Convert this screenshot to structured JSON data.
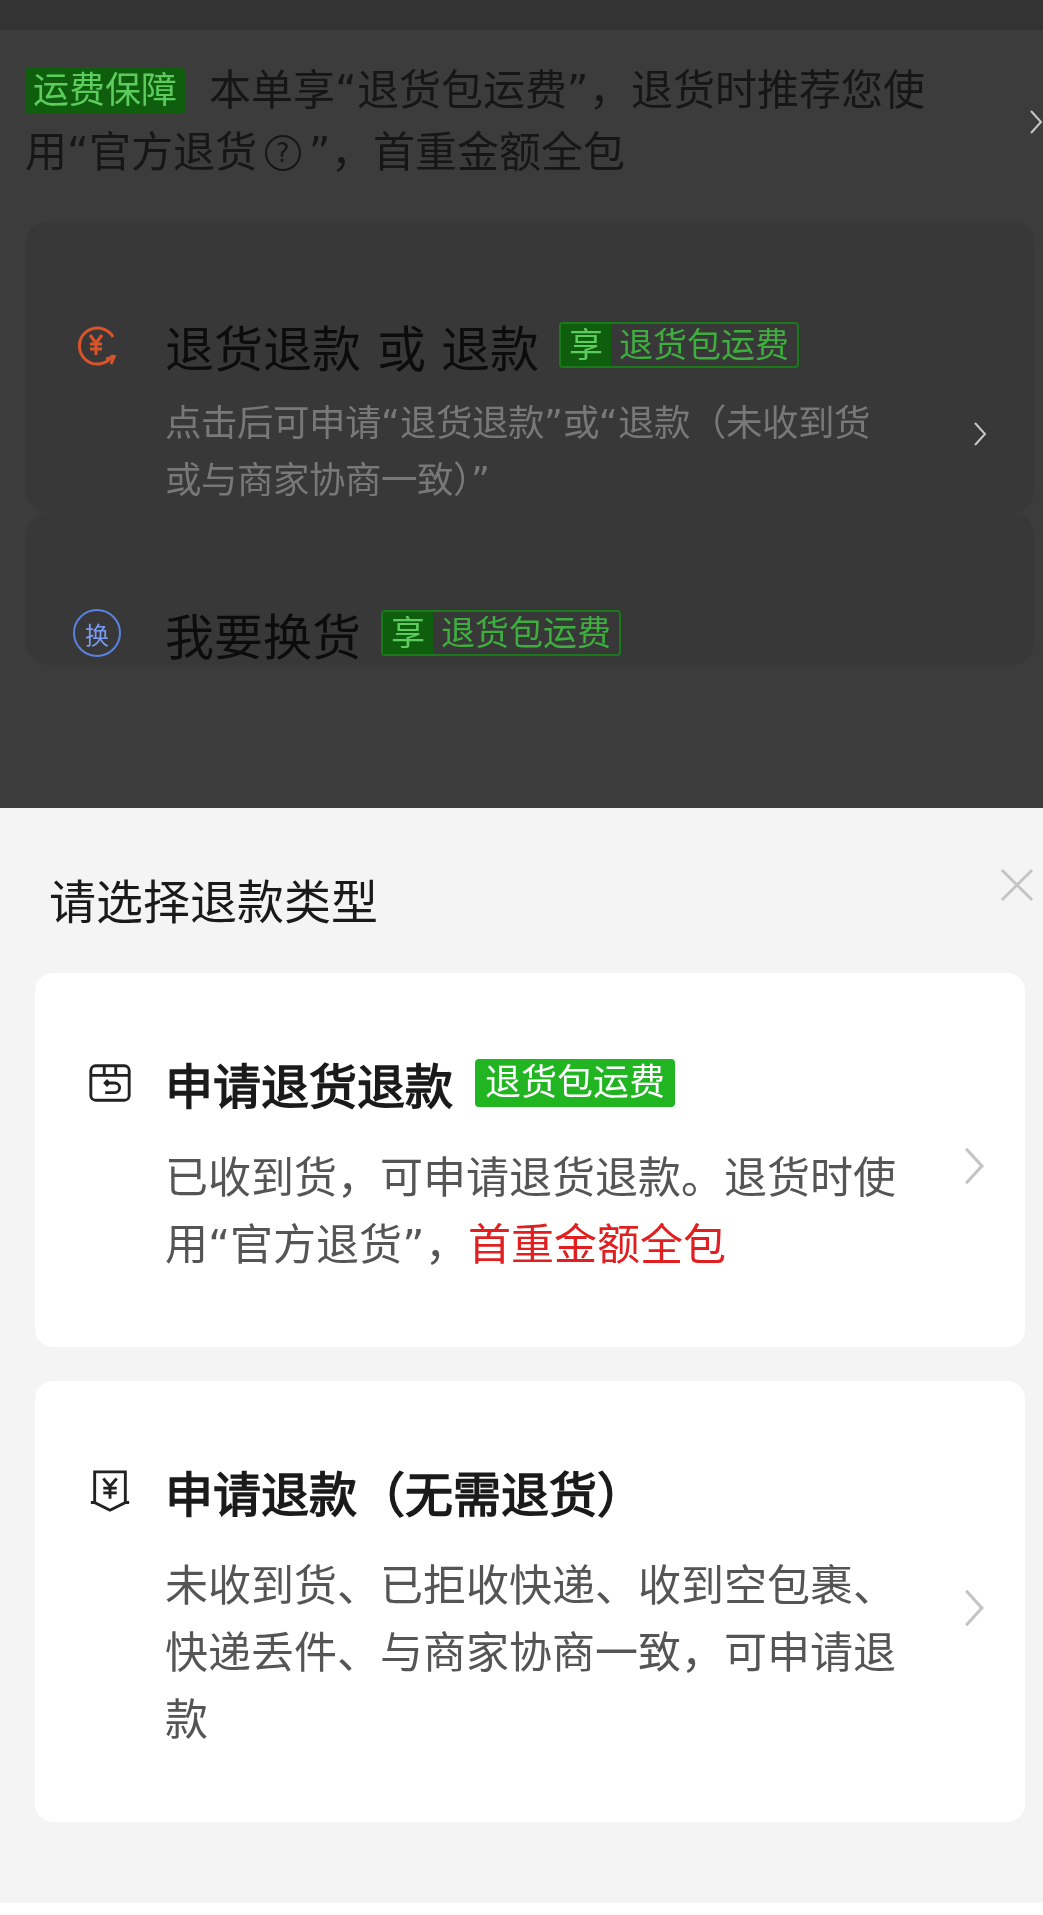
{
  "background_page": {
    "notice": {
      "badge": "运费保障",
      "line_1": "本单享“退货包运费”，退货时推荐您使",
      "line_2_before": "用“官方退货",
      "help_mark": "?",
      "line_2_after": "”，首重金额全包"
    },
    "options": [
      {
        "kind": "refund",
        "title": "退货退款 或 退款",
        "tag_prefix": "享",
        "tag": "退货包运费",
        "description": "点击后可申请“退货退款”或“退款（未收到货或与商家协商一致）”"
      },
      {
        "kind": "exchange",
        "icon_text": "换",
        "title": "我要换货",
        "tag_prefix": "享",
        "tag": "退货包运费"
      }
    ]
  },
  "sheet": {
    "title": "请选择退款类型",
    "options": [
      {
        "kind": "return",
        "title": "申请退货退款",
        "tag": "退货包运费",
        "description": [
          {
            "text": "已收到货，可申请退货退款。退货时使用“官方退货”，",
            "highlight": false
          },
          {
            "text": "首重金额全包",
            "highlight": true
          }
        ]
      },
      {
        "kind": "refund_only",
        "title": "申请退款（无需退货）",
        "description": [
          {
            "text": "未收到货、已拒收快递、收到空包裹、快递丢件、与商家协商一致，可申请退款",
            "highlight": false
          }
        ]
      }
    ]
  }
}
